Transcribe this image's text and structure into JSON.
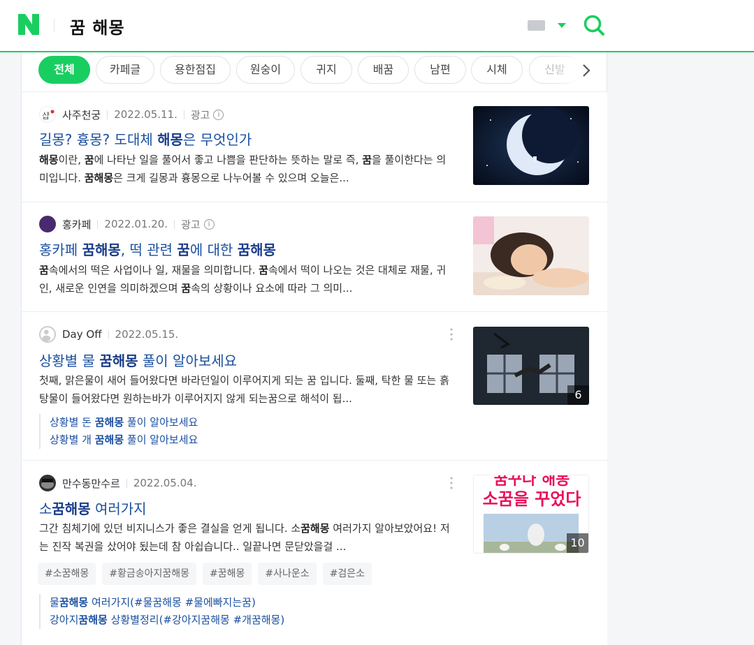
{
  "header": {
    "query": "꿈 해몽",
    "colors": {
      "brand": "#19ce60",
      "link": "#1a4fa0"
    }
  },
  "filters": {
    "chips": [
      "전체",
      "카페글",
      "용한점집",
      "원숭이",
      "귀지",
      "배꿈",
      "남편",
      "시체",
      "신발"
    ],
    "active_index": 0
  },
  "results": [
    {
      "source": "사주천궁",
      "date": "2022.05.11.",
      "ad_label": "광고",
      "title_parts": [
        [
          "길몽? 흉몽? 도대체 ",
          false
        ],
        [
          "해몽",
          true
        ],
        [
          "은 무엇인가",
          false
        ]
      ],
      "desc_parts": [
        [
          "해몽",
          true
        ],
        [
          "이란, ",
          false
        ],
        [
          "꿈",
          true
        ],
        [
          "에 나타난 일을 풀어서 좋고 나쁨을 판단하는 뜻하는 말로 즉, ",
          false
        ],
        [
          "꿈",
          true
        ],
        [
          "을 풀이한다는 의미입니다. ",
          false
        ],
        [
          "꿈해몽",
          true
        ],
        [
          "은 크게 길몽과 흉몽으로 나누어볼 수 있으며 오늘은...",
          false
        ]
      ],
      "thumb": "moon-image"
    },
    {
      "source": "홍카페",
      "date": "2022.01.20.",
      "ad_label": "광고",
      "title_parts": [
        [
          "홍카페 ",
          false
        ],
        [
          "꿈해몽",
          true
        ],
        [
          ", 떡 관련 ",
          false
        ],
        [
          "꿈",
          true
        ],
        [
          "에 대한 ",
          false
        ],
        [
          "꿈해몽",
          true
        ]
      ],
      "desc_parts": [
        [
          "꿈",
          true
        ],
        [
          "속에서의 떡은 사업이나 일, 재물을 의미합니다. ",
          false
        ],
        [
          "꿈",
          true
        ],
        [
          "속에서 떡이 나오는 것은 대체로 재물, 귀인, 새로운 인연을 의미하겠으며 ",
          false
        ],
        [
          "꿈",
          true
        ],
        [
          "속의 상황이나 요소에 따라 그 의미...",
          false
        ]
      ],
      "thumb": "sleeping-woman-image"
    },
    {
      "source": "Day Off",
      "date": "2022.05.15.",
      "title_parts": [
        [
          "상황별 물 ",
          false
        ],
        [
          "꿈해몽",
          true
        ],
        [
          " 풀이 알아보세요",
          false
        ]
      ],
      "desc_parts": [
        [
          "첫째, 맑은물이 새어 들어왔다면 바라던일이 이루어지게 되는 꿈 입니다. 둘째, 탁한 물 또는 흙탕물이 들어왔다면 원하는바가 이루어지지 않게 되는꿈으로 해석이 됩...",
          false
        ]
      ],
      "thumb": "falling-person-image",
      "thumb_count": "6",
      "sublinks": [
        [
          [
            "상황별 돈 ",
            false
          ],
          [
            "꿈해몽",
            true
          ],
          [
            " 풀이 알아보세요",
            false
          ]
        ],
        [
          [
            "상황별 개 ",
            false
          ],
          [
            "꿈해몽",
            true
          ],
          [
            " 풀이 알아보세요",
            false
          ]
        ]
      ]
    },
    {
      "source": "만수동만수르",
      "date": "2022.05.04.",
      "title_parts": [
        [
          "소",
          false
        ],
        [
          "꿈해몽",
          true
        ],
        [
          " 여러가지",
          false
        ]
      ],
      "desc_parts": [
        [
          "그간 침체기에 있던 비지니스가 좋은 결실을 얻게 됩니다. 소",
          false
        ],
        [
          "꿈해몽",
          true
        ],
        [
          " 여러가지 알아보았어요! 저는 진작 복권을 샀어야 됬는데 참 아쉽습니다.. 일끝나면 문닫았을걸 ...",
          false
        ]
      ],
      "thumb": "cow-dream-image",
      "thumb_text_top": "꿈꾸다 해몽",
      "thumb_text": "소꿈을 꾸었다",
      "thumb_count": "10",
      "tags": [
        "#소꿈해몽",
        "#황금송아지꿈해몽",
        "#꿈해몽",
        "#사나운소",
        "#검은소"
      ],
      "sublinks": [
        [
          [
            "물",
            false
          ],
          [
            "꿈해몽",
            true
          ],
          [
            " 여러가지(#물꿈해몽 #물에빠지는꿈)",
            false
          ]
        ],
        [
          [
            "강아지",
            false
          ],
          [
            "꿈해몽",
            true
          ],
          [
            " 상황별정리(#강아지꿈해몽 #개꿈해몽)",
            false
          ]
        ]
      ]
    }
  ]
}
